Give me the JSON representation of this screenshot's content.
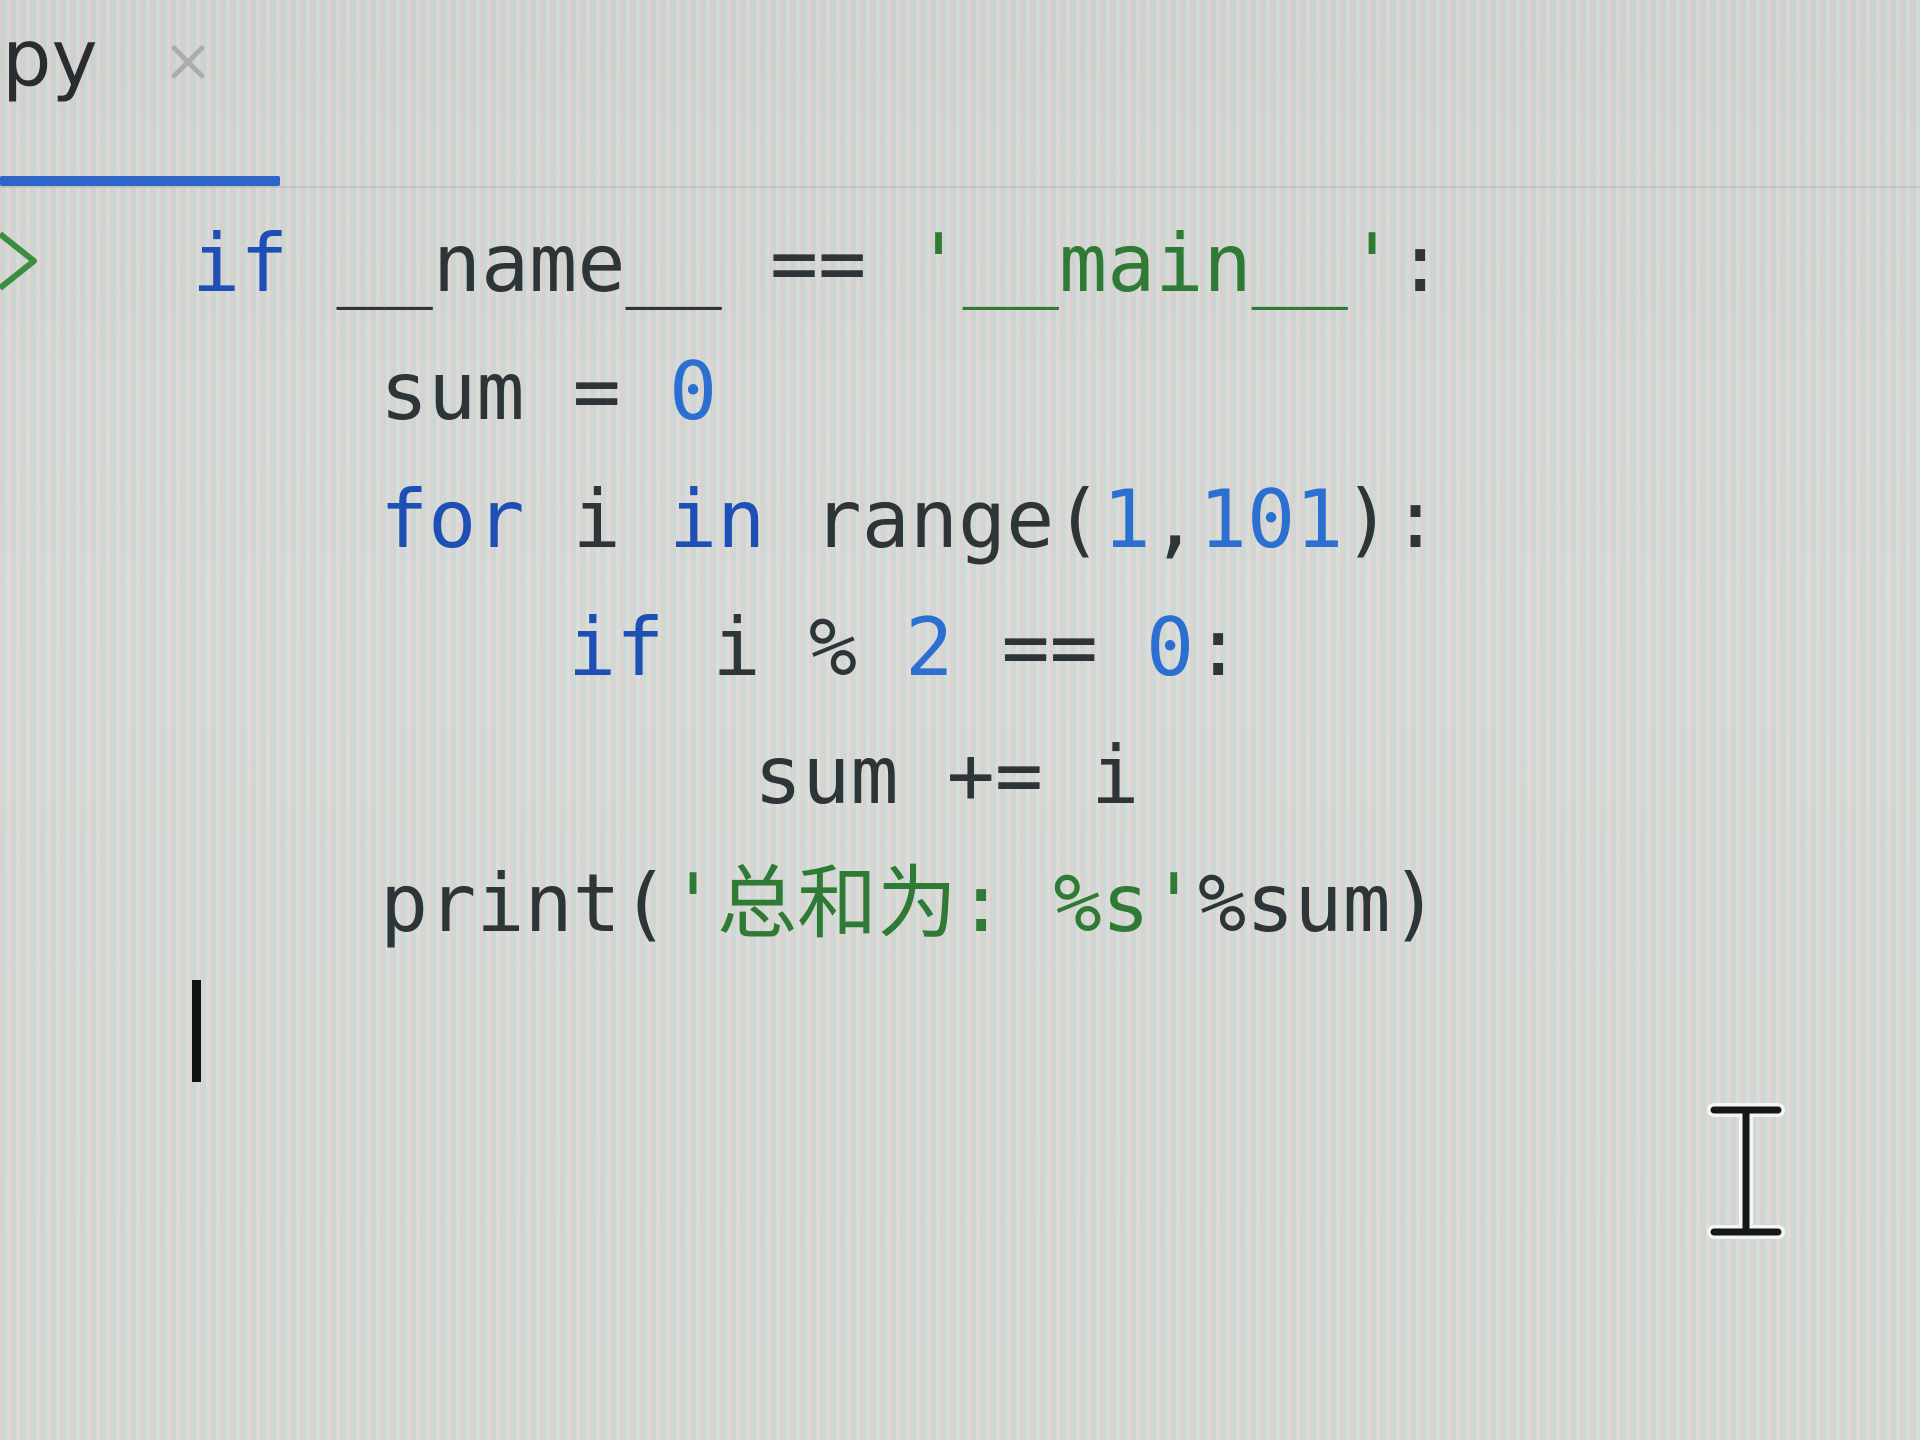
{
  "tab": {
    "label": "py",
    "close_glyph": "×"
  },
  "code_lines": [
    [
      {
        "t": "if",
        "c": "kw"
      },
      {
        "t": " __name__ ",
        "c": "plain"
      },
      {
        "t": "==",
        "c": "op"
      },
      {
        "t": " '__main__'",
        "c": "str"
      },
      {
        "t": ":",
        "c": "plain"
      }
    ],
    [
      {
        "t": "sum ",
        "c": "plain"
      },
      {
        "t": "=",
        "c": "op"
      },
      {
        "t": " ",
        "c": "plain"
      },
      {
        "t": "0",
        "c": "num"
      }
    ],
    [
      {
        "t": "for",
        "c": "kw"
      },
      {
        "t": " i ",
        "c": "plain"
      },
      {
        "t": "in",
        "c": "kw"
      },
      {
        "t": " range(",
        "c": "plain"
      },
      {
        "t": "1",
        "c": "num"
      },
      {
        "t": ",",
        "c": "plain"
      },
      {
        "t": "101",
        "c": "num"
      },
      {
        "t": "):",
        "c": "plain"
      }
    ],
    [
      {
        "t": "if",
        "c": "kw"
      },
      {
        "t": " i ",
        "c": "plain"
      },
      {
        "t": "%",
        "c": "op"
      },
      {
        "t": " ",
        "c": "plain"
      },
      {
        "t": "2",
        "c": "num"
      },
      {
        "t": " == ",
        "c": "op"
      },
      {
        "t": "0",
        "c": "num"
      },
      {
        "t": ":",
        "c": "plain"
      }
    ],
    [
      {
        "t": "sum ",
        "c": "plain"
      },
      {
        "t": "+=",
        "c": "op"
      },
      {
        "t": " i",
        "c": "plain"
      }
    ],
    [
      {
        "t": "print(",
        "c": "plain"
      },
      {
        "t": "'总和为: %s'",
        "c": "str"
      },
      {
        "t": "%sum)",
        "c": "plain"
      }
    ]
  ],
  "cursor_icon": "i-beam-cursor-icon",
  "gutter_icon": "run-arrow-icon",
  "colors": {
    "keyword": "#1d4fb4",
    "number": "#2b6fd0",
    "string": "#2f7a34",
    "tab_accent": "#2f64c8"
  }
}
